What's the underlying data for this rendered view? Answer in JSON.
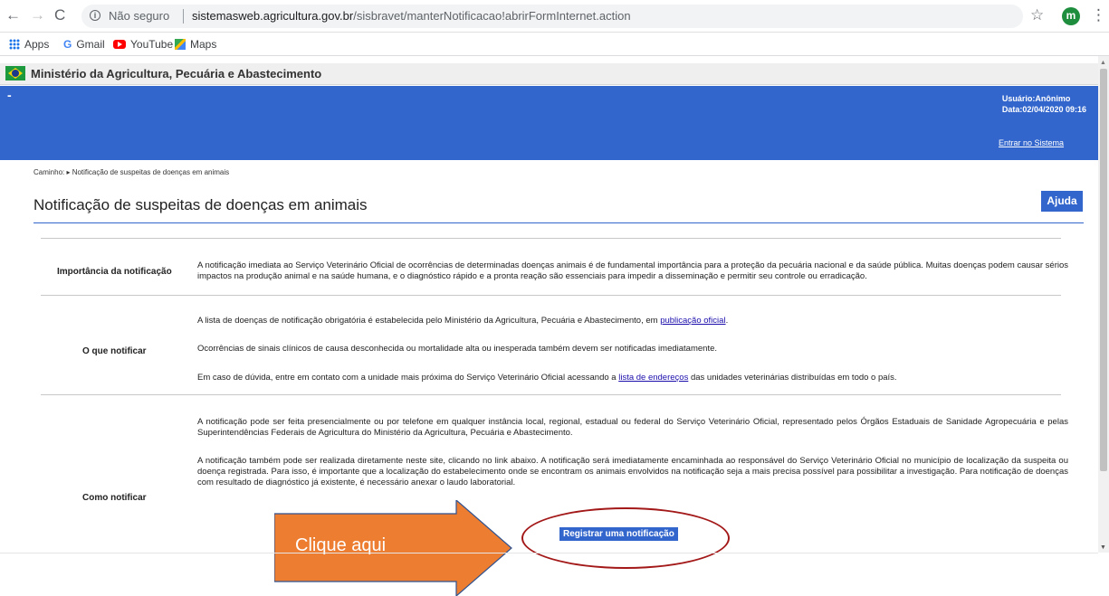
{
  "browser": {
    "back_icon": "←",
    "forward_icon": "→",
    "reload_icon": "C",
    "info_icon": "i",
    "security_label": "Não seguro",
    "url_host": "sistemasweb.agricultura.gov.br",
    "url_path": "/sisbravet/manterNotificacao!abrirFormInternet.action",
    "star_icon": "☆",
    "profile_initial": "m",
    "menu_icon": "⋮"
  },
  "bookmarks": {
    "apps": "Apps",
    "gmail_logo": "G",
    "gmail": "Gmail",
    "youtube": "YouTube",
    "maps": "Maps"
  },
  "gov_bar": {
    "title": "Ministério da Agricultura, Pecuária e Abastecimento"
  },
  "header": {
    "dash": "-",
    "user": "Usuário:Anônimo",
    "date": "Data:02/04/2020 09:16",
    "login_link": "Entrar no Sistema"
  },
  "breadcrumb": "Caminho: ▸ Notificação de suspeitas de doenças em animais",
  "page_title": "Notificação de suspeitas de doenças em animais",
  "help_button": "Ajuda",
  "sections": {
    "importance": {
      "label": "Importância da notificação",
      "text": "A notificação imediata ao Serviço Veterinário Oficial de ocorrências de determinadas doenças animais é de fundamental importância para a proteção da pecuária nacional e da saúde pública. Muitas doenças podem causar sérios impactos na produção animal e na saúde humana, e o diagnóstico rápido e a pronta reação são essenciais para impedir a disseminação e permitir seu controle ou erradicação."
    },
    "what": {
      "label": "O que notificar",
      "p1_before": "A lista de doenças de notificação obrigatória é estabelecida pelo Ministério da Agricultura, Pecuária e Abastecimento, em ",
      "p1_link": "publicação oficial",
      "p1_after": ".",
      "p2": "Ocorrências de sinais clínicos de causa desconhecida ou mortalidade alta ou inesperada também devem ser notificadas imediatamente.",
      "p3_before": "Em caso de dúvida, entre em contato com a unidade mais próxima do Serviço Veterinário Oficial acessando a ",
      "p3_link": "lista de endereços",
      "p3_after": " das unidades veterinárias distribuídas em todo o país."
    },
    "how": {
      "label": "Como notificar",
      "p1": "A notificação pode ser feita presencialmente ou por telefone em qualquer instância local, regional, estadual ou federal do Serviço Veterinário Oficial, representado pelos Órgãos Estaduais de Sanidade Agropecuária e pelas Superintendências Federais de Agricultura do Ministério da Agricultura, Pecuária e Abastecimento.",
      "p2": "A notificação também pode ser realizada diretamente neste site, clicando no link abaixo. A notificação será imediatamente encaminhada ao responsável do Serviço Veterinário Oficial no município de localização da suspeita ou doença registrada. Para isso, é importante que a localização do estabelecimento onde se encontram os animais envolvidos na notificação seja a mais precisa possível para possibilitar a investigação. Para notificação de doenças com resultado de diagnóstico já existente, é necessário anexar o laudo laboratorial.",
      "register_button": "Registrar uma notificação"
    }
  },
  "annotation": {
    "arrow_label": "Clique aqui",
    "arrow_color": "#ed7d31",
    "ellipse_color": "#a31818"
  },
  "scrollbar": {
    "up_icon": "▲",
    "down_icon": "▼"
  },
  "colors": {
    "header_blue": "#3366cc",
    "link": "#1a0dab"
  }
}
